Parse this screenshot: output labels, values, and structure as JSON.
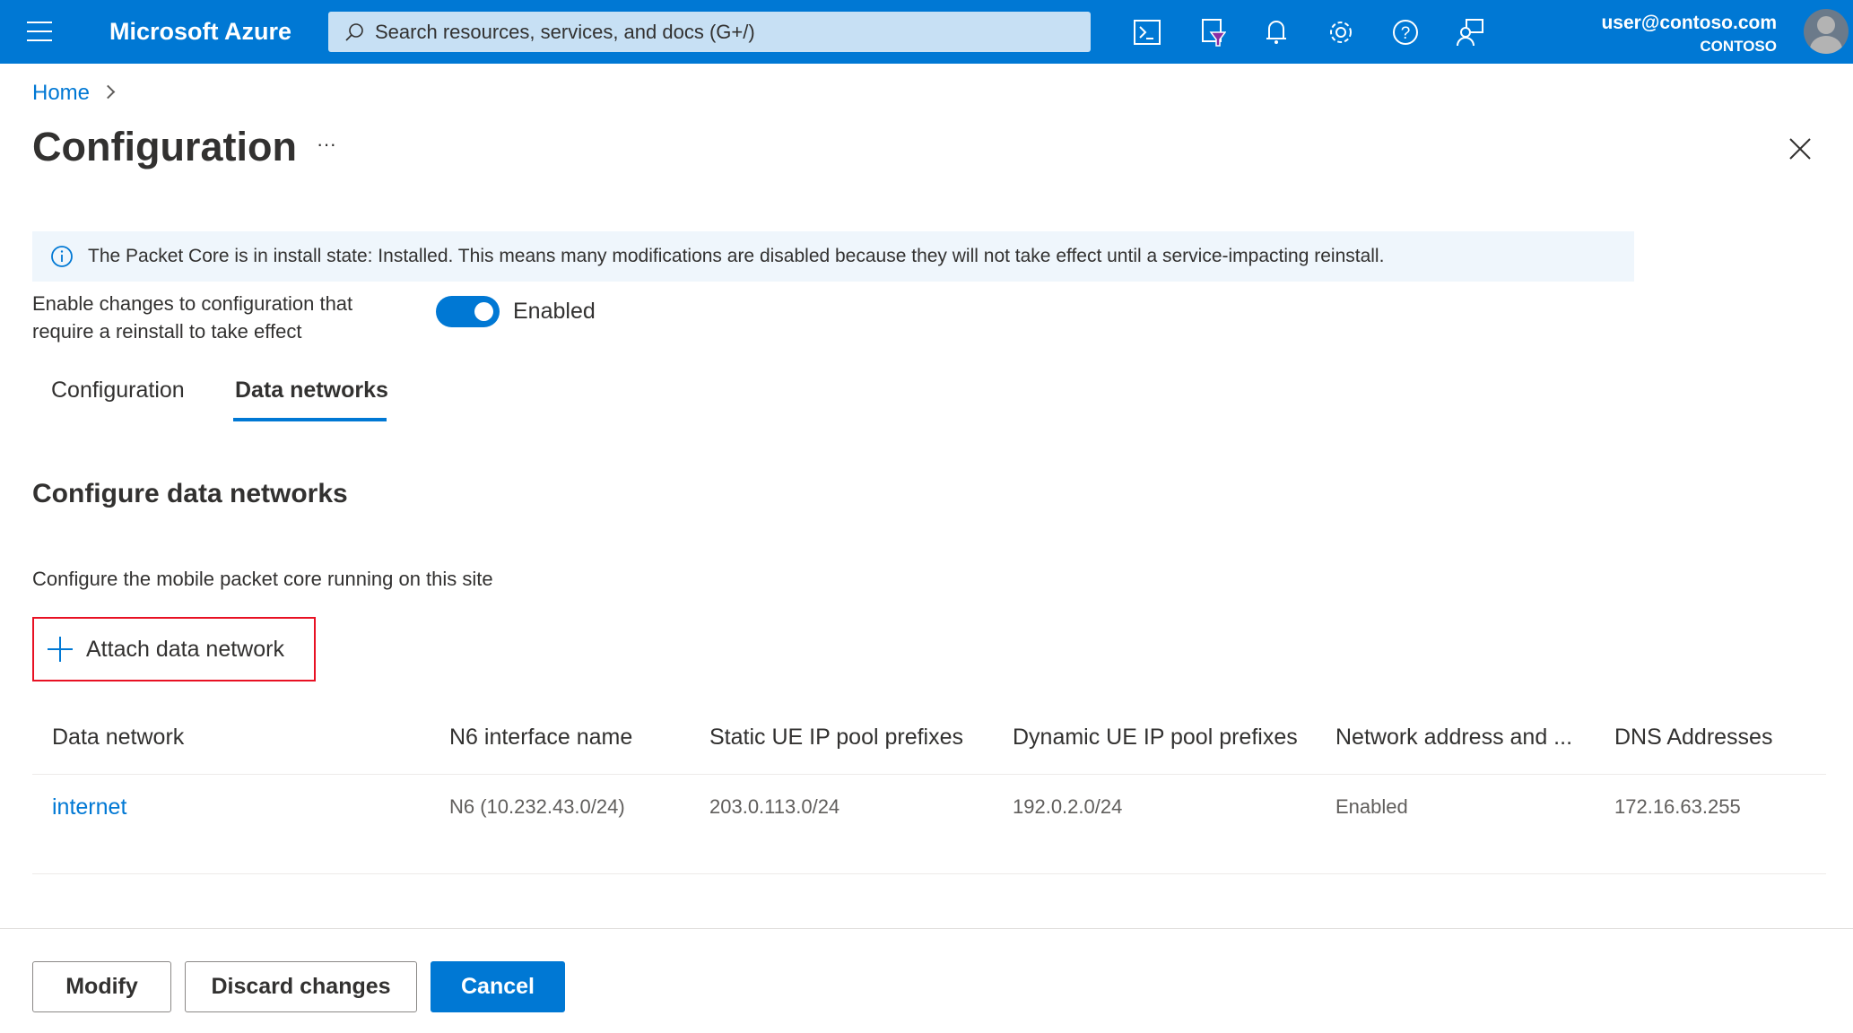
{
  "header": {
    "app_title": "Microsoft Azure",
    "search_placeholder": "Search resources, services, and docs (G+/)",
    "user_email": "user@contoso.com",
    "tenant": "CONTOSO"
  },
  "breadcrumb": {
    "home": "Home"
  },
  "page": {
    "title": "Configuration",
    "more": "···"
  },
  "banner": {
    "text": "The Packet Core is in install state: Installed. This means many modifications are disabled because they will not take effect until a service-impacting reinstall."
  },
  "toggle": {
    "label_line1": "Enable changes to configuration that",
    "label_line2": "require a reinstall to take effect",
    "state": "Enabled"
  },
  "tabs": [
    {
      "label": "Configuration"
    },
    {
      "label": "Data networks"
    }
  ],
  "section": {
    "title": "Configure data networks",
    "description": "Configure the mobile packet core running on this site",
    "attach_label": "Attach data network"
  },
  "table": {
    "headers": [
      "Data network",
      "N6 interface name",
      "Static UE IP pool prefixes",
      "Dynamic UE IP pool prefixes",
      "Network address and ...",
      "DNS Addresses"
    ],
    "rows": [
      [
        "internet",
        "N6 (10.232.43.0/24)",
        "203.0.113.0/24",
        "192.0.2.0/24",
        "Enabled",
        "172.16.63.255"
      ]
    ]
  },
  "footer": {
    "modify": "Modify",
    "discard": "Discard changes",
    "cancel": "Cancel"
  }
}
